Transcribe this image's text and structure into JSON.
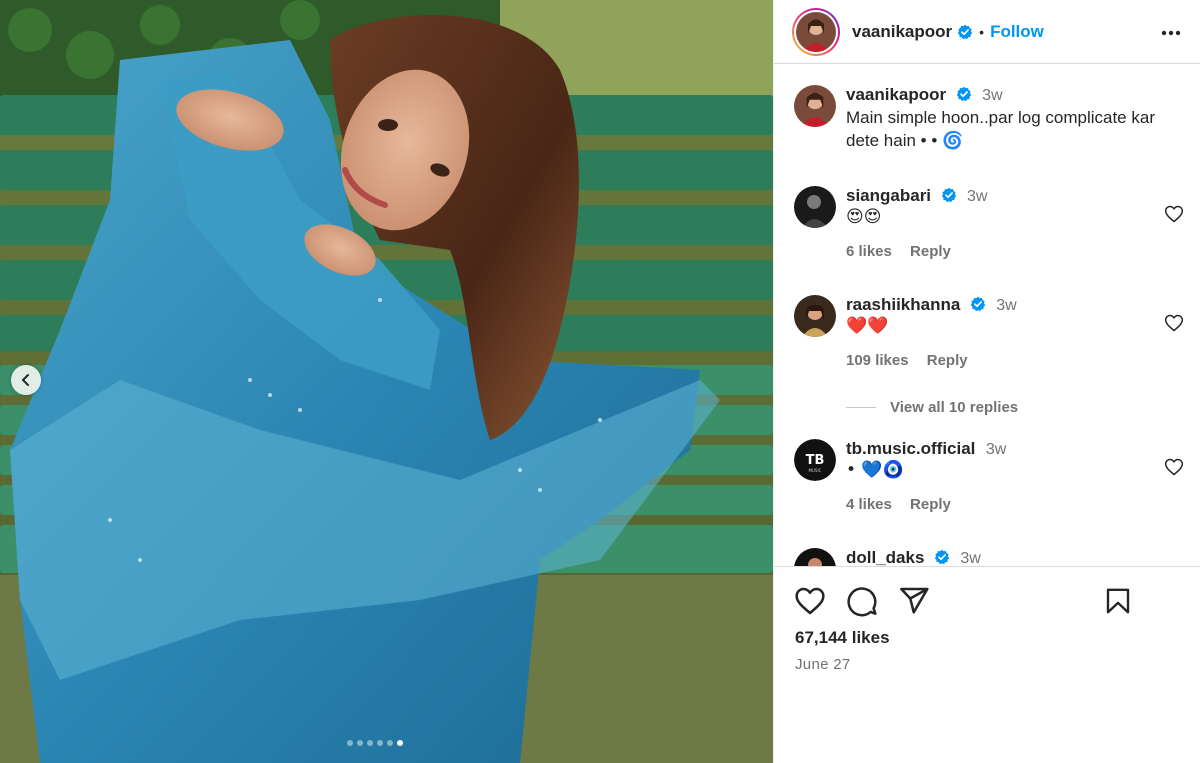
{
  "post": {
    "username": "vaanikapoor",
    "follow_label": "Follow",
    "caption_time": "3w",
    "caption_text": "Main simple hoon..par log complicate kar dete hain •   •   🌀",
    "likes": "67,144 likes",
    "date": "June 27",
    "carousel": {
      "total_slides": 6,
      "active_slide": 6
    }
  },
  "comments": [
    {
      "username": "siangabari",
      "verified": true,
      "time": "3w",
      "text": "😍😍",
      "likes": "6 likes",
      "reply": "Reply"
    },
    {
      "username": "raashiikhanna",
      "verified": true,
      "time": "3w",
      "text": "❤️❤️",
      "likes": "109 likes",
      "reply": "Reply",
      "view_replies": "View all 10 replies"
    },
    {
      "username": "tb.music.official",
      "verified": false,
      "time": "3w",
      "text": "•   💙🧿",
      "likes": "4 likes",
      "reply": "Reply"
    },
    {
      "username": "doll_daks",
      "verified": true,
      "time": "3w"
    }
  ],
  "icons": {
    "verified": "verified-badge-icon",
    "more": "more-options-icon",
    "like": "heart-icon",
    "comment": "comment-icon",
    "share": "share-icon",
    "save": "bookmark-icon",
    "prev": "chevron-left-icon"
  },
  "colors": {
    "link": "#0095f6",
    "verified": "#0095f6",
    "text": "#262626",
    "muted": "#737373",
    "heart": "#ed4956"
  }
}
